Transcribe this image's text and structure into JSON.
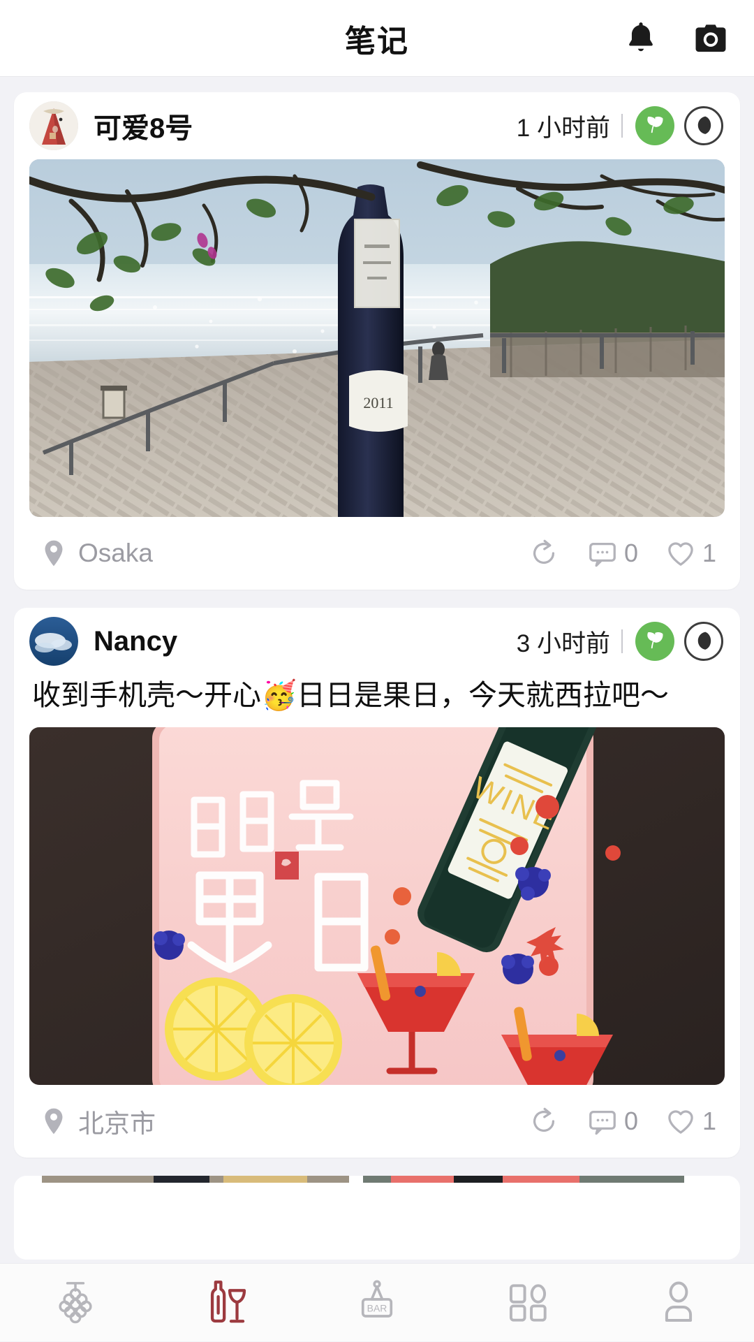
{
  "header": {
    "title": "笔记",
    "bell_icon": "bell-icon",
    "camera_icon": "camera-icon"
  },
  "posts": [
    {
      "username": "可爱8号",
      "avatar_icon": "avatar-gift-pouch",
      "time_ago": "1 小时前",
      "badges": [
        {
          "name": "leaf-badge",
          "color": "#66bb56",
          "icon": "leaf-icon"
        },
        {
          "name": "wine-drop-badge",
          "color": "#3d3d3d",
          "icon": "dark-circle-icon"
        }
      ],
      "text": "",
      "media_alt": "wine-bottle-lakeside-photo",
      "location": "Osaka",
      "share_icon": "share-icon",
      "comment_icon": "comment-icon",
      "comments": "0",
      "like_icon": "heart-icon",
      "likes": "1"
    },
    {
      "username": "Nancy",
      "avatar_icon": "avatar-blue-sky",
      "time_ago": "3 小时前",
      "badges": [
        {
          "name": "leaf-badge",
          "color": "#66bb56",
          "icon": "leaf-icon"
        },
        {
          "name": "wine-drop-badge",
          "color": "#3d3d3d",
          "icon": "dark-circle-icon"
        }
      ],
      "text": "收到手机壳～开心🥳日日是果日，今天就西拉吧～",
      "media_alt": "wine-phone-case-illustration",
      "location": "北京市",
      "share_icon": "share-icon",
      "comment_icon": "comment-icon",
      "comments": "0",
      "like_icon": "heart-icon",
      "likes": "1"
    }
  ],
  "tabbar": {
    "active_index": 1,
    "active_color": "#9c3a3f",
    "inactive_color": "#b6b6bb",
    "items": [
      {
        "name": "tab-grapes",
        "icon": "grapes-icon"
      },
      {
        "name": "tab-notes",
        "icon": "bottle-glass-icon"
      },
      {
        "name": "tab-bar",
        "icon": "bar-sign-icon",
        "label": "BAR"
      },
      {
        "name": "tab-discover",
        "icon": "grid-icon"
      },
      {
        "name": "tab-profile",
        "icon": "person-icon"
      }
    ]
  }
}
